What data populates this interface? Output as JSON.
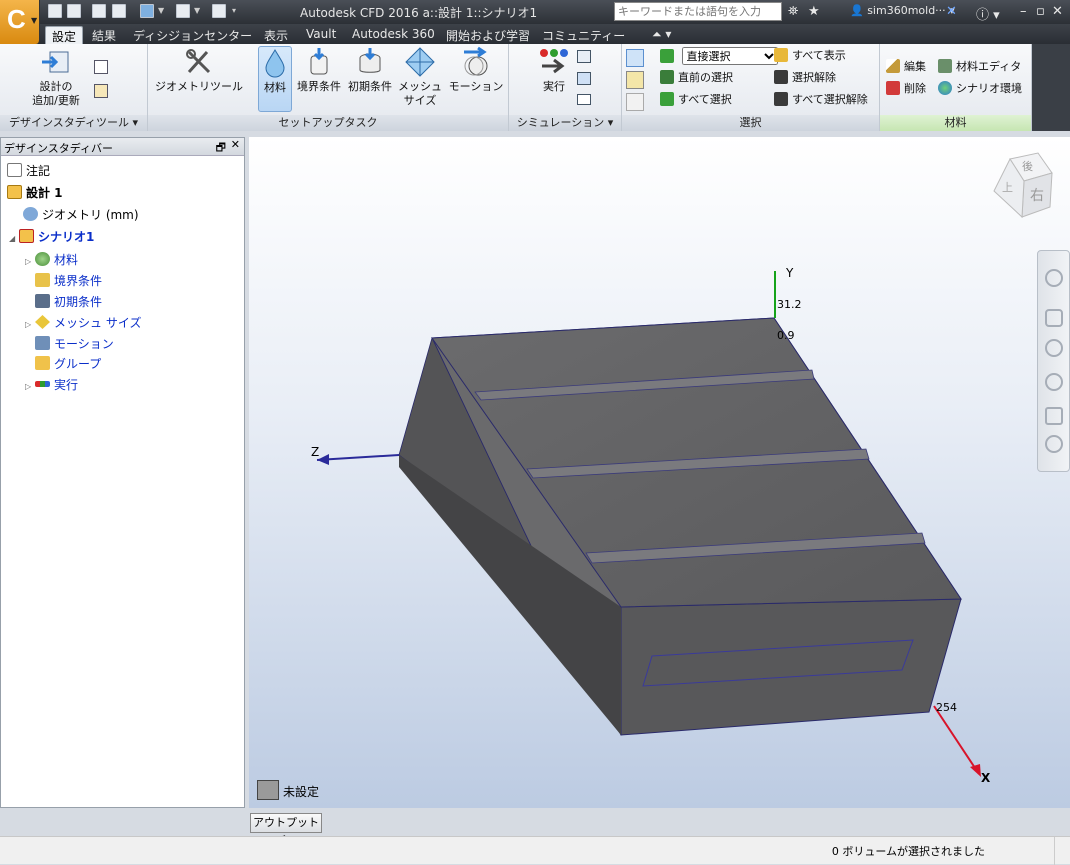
{
  "window": {
    "title": "Autodesk CFD 2016   a::設計 1::シナリオ1"
  },
  "app_button": {
    "letter": "C"
  },
  "search": {
    "placeholder": "キーワードまたは語句を入力"
  },
  "user": {
    "name": "sim360mold···"
  },
  "tabs": [
    {
      "label": "設定",
      "active": true
    },
    {
      "label": "結果"
    },
    {
      "label": "ディシジョンセンター"
    },
    {
      "label": "表示"
    },
    {
      "label": "Vault"
    },
    {
      "label": "Autodesk 360"
    },
    {
      "label": "開始および学習"
    },
    {
      "label": "コミュニティー"
    }
  ],
  "ribbon": {
    "design_study": {
      "label": "デザインスタディツール",
      "add_update_line1": "設計の",
      "add_update_line2": "追加/更新"
    },
    "setup": {
      "label": "セットアップタスク",
      "geometry_tool": "ジオメトリツール",
      "material": "材料",
      "boundary": "境界条件",
      "initial": "初期条件",
      "mesh_line1": "メッシュ",
      "mesh_line2": "サイズ",
      "motion": "モーション"
    },
    "simulation": {
      "label": "シミュレーション",
      "run": "実行"
    },
    "selection": {
      "label": "選択",
      "mode_value": "直接選択",
      "previous": "直前の選択",
      "select_all": "すべて選択",
      "show_all": "すべて表示",
      "deselect": "選択解除",
      "deselect_all": "すべて選択解除"
    },
    "material_panel": {
      "label": "材料",
      "edit": "編集",
      "delete": "削除",
      "material_editor": "材料エディタ",
      "scenario_env": "シナリオ環境"
    }
  },
  "design_study_bar": {
    "title": "デザインスタディバー",
    "tree": [
      {
        "label": "注記"
      },
      {
        "label": "設計 1"
      },
      {
        "label": "ジオメトリ (mm)"
      },
      {
        "label": "シナリオ1"
      },
      {
        "label": "材料"
      },
      {
        "label": "境界条件"
      },
      {
        "label": "初期条件"
      },
      {
        "label": "メッシュ サイズ"
      },
      {
        "label": "モーション"
      },
      {
        "label": "グループ"
      },
      {
        "label": "実行"
      }
    ]
  },
  "viewport": {
    "axis_y": "Y",
    "axis_z": "Z",
    "axis_x": "X",
    "dim_y1": "31.2",
    "dim_y2": "0.9",
    "dim_x": "254",
    "legend_label": "未設定",
    "viewcube_top": "後",
    "viewcube_front": "右",
    "viewcube_left": "上"
  },
  "output_bar": {
    "label": "アウトプットバー"
  },
  "status": {
    "text": "0 ボリュームが選択されました"
  },
  "colors": {
    "accent_orange": "#e59a1c",
    "selected_blue": "#b9d6f4",
    "link_blue": "#0a2ec9",
    "axis_red": "#d8142a",
    "axis_green": "#16a31a",
    "axis_blue": "#2a2a9a",
    "model_gray": "#5c5c5e"
  }
}
